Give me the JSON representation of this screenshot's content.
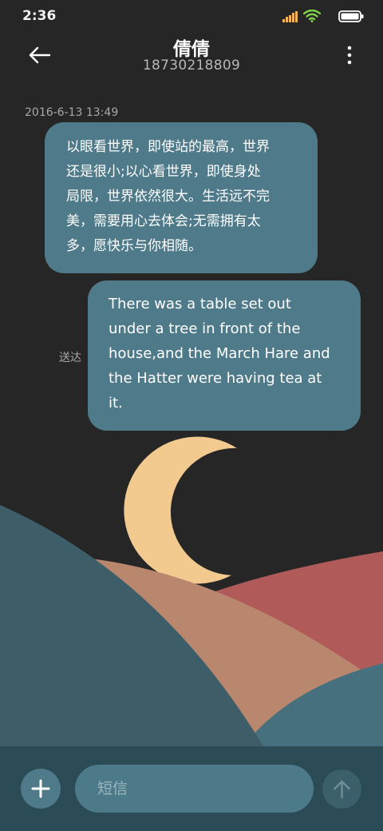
{
  "status_bar": {
    "time": "2:36",
    "icons": [
      "signal-icon",
      "wifi-icon",
      "battery-icon"
    ]
  },
  "header": {
    "title": "倩倩",
    "subtitle": "18730218809",
    "back_icon": "arrow-left-icon",
    "menu_icon": "more-vertical-icon"
  },
  "conversation": {
    "timestamp": "2016-6-13 13:49",
    "received_message": {
      "lines": [
        "以眼看世界，即使站的最高，世界",
        "还是很小;以心看世界，即使身处",
        "局限，世界依然很大。生活远不完",
        "美，需要用心去体会;无需拥有太",
        "多，愿快乐与你相随。"
      ]
    },
    "sent_message": {
      "lines": [
        "There was a table set out",
        "under a tree in front of the",
        "house,and the March Hare and",
        "the Hatter were having tea at",
        "it."
      ],
      "status": "送达"
    }
  },
  "composer": {
    "placeholder": "短信",
    "add_icon": "plus-icon",
    "send_icon": "arrow-up-icon"
  },
  "colors": {
    "background": "#262626",
    "bubble": "#4f7a8a",
    "moon": "#f2c98e",
    "hill_brown": "#b8876e",
    "hill_red": "#b05b59",
    "hill_teal": "#3d5d68"
  }
}
